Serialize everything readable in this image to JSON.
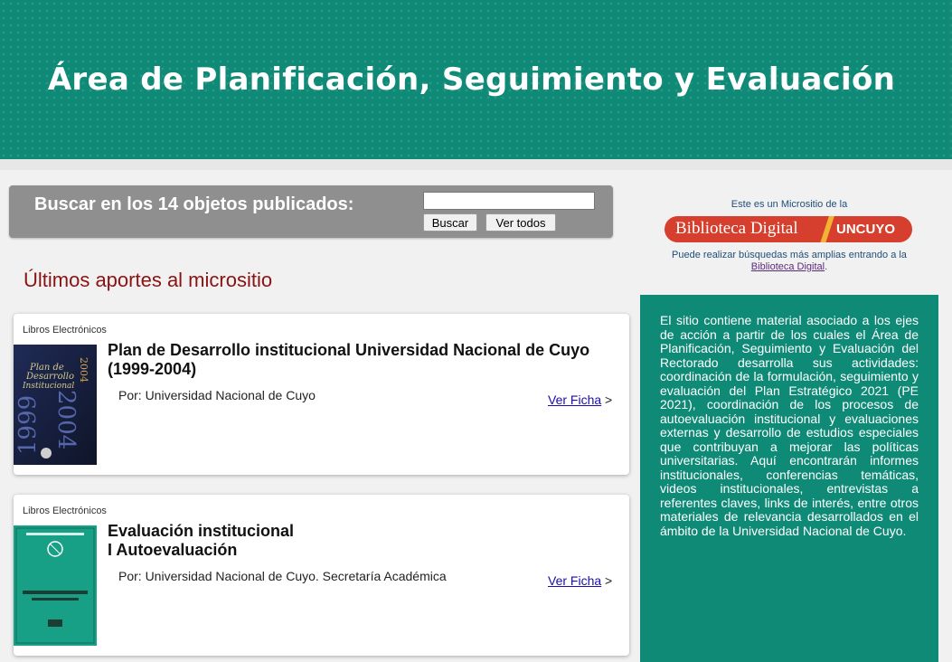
{
  "banner": {
    "title": "Área de Planificación, Seguimiento y Evaluación"
  },
  "search": {
    "label": "Buscar en los 14 objetos publicados:",
    "input_value": "",
    "buscar_button": "Buscar",
    "ver_todos_button": "Ver todos"
  },
  "section": {
    "title": "Últimos aportes al micrositio"
  },
  "items": [
    {
      "category": "Libros Electrónicos",
      "title": "Plan de Desarrollo institucional Universidad Nacional de Cuyo (1999-2004)",
      "author": "Por: Universidad Nacional de Cuyo",
      "link": "Ver Ficha",
      "link_arrow": ">",
      "cover_text": "Plan de Desarrollo Institucional",
      "cover_years": "1999 · 2004"
    },
    {
      "category": "Libros Electrónicos",
      "title_line1": "Evaluación institucional",
      "title_line2": "I Autoevaluación",
      "author": "Por: Universidad Nacional de Cuyo. Secretaría Académica",
      "link": "Ver Ficha",
      "link_arrow": ">",
      "cover_text": "EVALUACIÓN INSTITUCIONAL",
      "cover_sub": "I. Autoevaluación"
    }
  ],
  "sidebar": {
    "intro": "Este es un Micrositio de la",
    "logo_left": "Biblioteca Digital",
    "logo_right": "UNCUYO",
    "more_text": "Puede realizar búsquedas más amplias entrando a la",
    "more_link": "Biblioteca Digital",
    "more_end": ".",
    "description": "El sitio contiene material asociado a los ejes de acción a partir de los cuales el Área de Planificación, Seguimiento y Evaluación del Rectorado desarrolla sus actividades: coordinación de la formulación, seguimiento y evaluación del Plan Estratégico 2021 (PE 2021), coordinación de los procesos de autoevaluación institucional y evaluaciones externas y desarrollo de estudios especiales que contribuyan a mejorar las políticas universitarias. Aquí encontrarán informes institucionales, conferencias temáticas, videos institucionales, entrevistas a referentes claves, links de interés, entre otros materiales de relevancia desarrollados en el ámbito de la Universidad Nacional de Cuyo."
  },
  "colors": {
    "brand_teal": "#0f8a77",
    "title_red": "#8b1212",
    "logo_red": "#d63f2d",
    "logo_accent": "#f2b233"
  }
}
